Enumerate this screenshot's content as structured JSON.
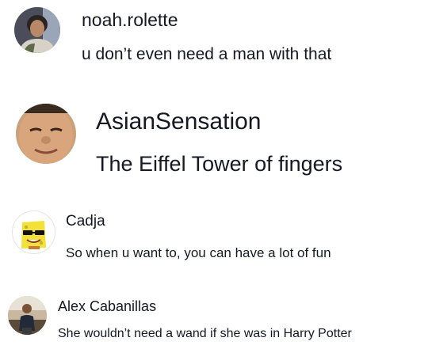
{
  "comments": [
    {
      "username": "noah.rolette",
      "text": "u don’t even need a man with that",
      "avatar_icon": "user-avatar-photo"
    },
    {
      "username": "AsianSensation",
      "text": "The Eiffel Tower of fingers",
      "avatar_icon": "user-avatar-photo"
    },
    {
      "username": "Cadja",
      "text": "So when u want to, you can have a lot of fun",
      "avatar_icon": "spongebob-avatar"
    },
    {
      "username": "Alex Cabanillas",
      "text": "She wouldn’t need a wand if she was in Harry Potter",
      "avatar_icon": "user-avatar-photo"
    }
  ],
  "colors": {
    "background": "#ffffff",
    "text": "#161823"
  }
}
